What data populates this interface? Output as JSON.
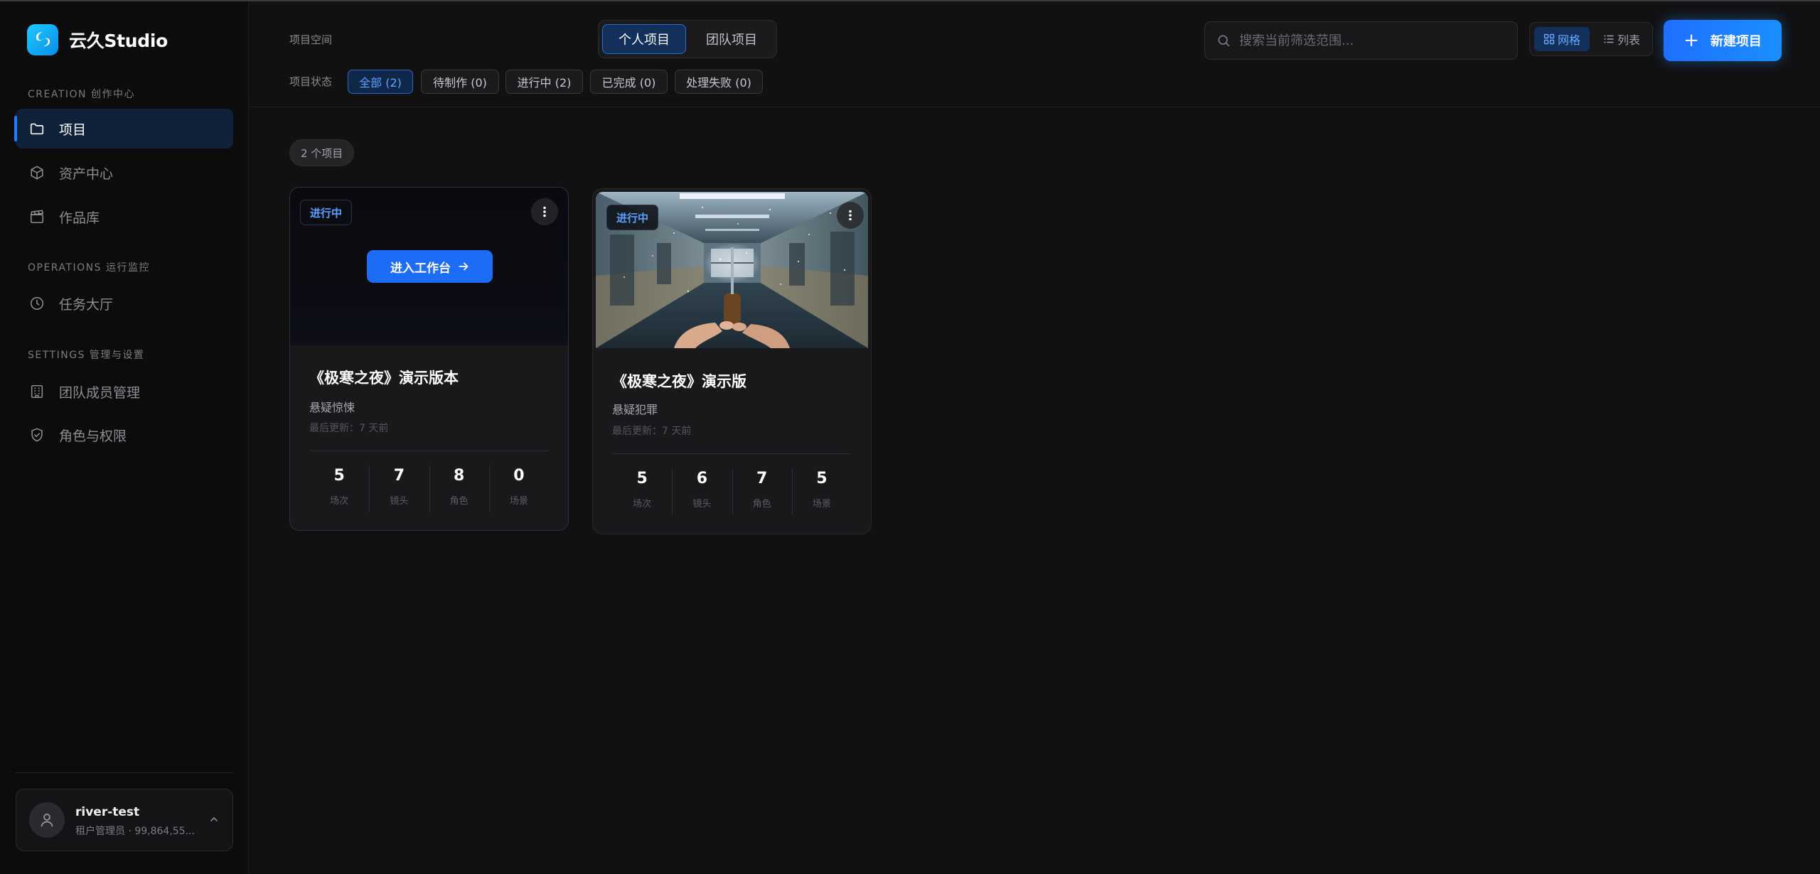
{
  "app": {
    "name": "云久Studio"
  },
  "sidebar": {
    "sections": [
      {
        "label": "CREATION 创作中心"
      },
      {
        "label": "OPERATIONS 运行监控"
      },
      {
        "label": "SETTINGS 管理与设置"
      }
    ],
    "items": [
      {
        "label": "项目",
        "icon": "folder-icon",
        "active": true
      },
      {
        "label": "资产中心",
        "icon": "cube-icon"
      },
      {
        "label": "作品库",
        "icon": "clapperboard-icon"
      },
      {
        "label": "任务大厅",
        "icon": "clock-icon"
      },
      {
        "label": "团队成员管理",
        "icon": "building-icon"
      },
      {
        "label": "角色与权限",
        "icon": "shield-check-icon"
      }
    ]
  },
  "user": {
    "name": "river-test",
    "role": "租户管理员 · 99,864,55..."
  },
  "toolbar": {
    "space_label": "项目空间",
    "space_tabs": [
      {
        "label": "个人项目",
        "active": true
      },
      {
        "label": "团队项目"
      }
    ],
    "status_label": "项目状态",
    "status_chips": [
      {
        "label": "全部 (2)",
        "active": true
      },
      {
        "label": "待制作 (0)"
      },
      {
        "label": "进行中 (2)"
      },
      {
        "label": "已完成 (0)"
      },
      {
        "label": "处理失败 (0)"
      }
    ],
    "search_placeholder": "搜索当前筛选范围...",
    "view_grid": "网格",
    "view_list": "列表",
    "new_project": "新建项目"
  },
  "count_label": "2 个项目",
  "projects": [
    {
      "status": "进行中",
      "enter_label": "进入工作台",
      "title": "《极寒之夜》演示版本",
      "genre": "悬疑惊悚",
      "updated": "最后更新：7 天前",
      "stats": [
        {
          "value": "5",
          "label": "场次"
        },
        {
          "value": "7",
          "label": "镜头"
        },
        {
          "value": "8",
          "label": "角色"
        },
        {
          "value": "0",
          "label": "场景"
        }
      ]
    },
    {
      "status": "进行中",
      "title": "《极寒之夜》演示版",
      "genre": "悬疑犯罪",
      "updated": "最后更新：7 天前",
      "stats": [
        {
          "value": "5",
          "label": "场次"
        },
        {
          "value": "6",
          "label": "镜头"
        },
        {
          "value": "7",
          "label": "角色"
        },
        {
          "value": "5",
          "label": "场景"
        }
      ]
    }
  ],
  "colors": {
    "accent": "#1f7cff",
    "background": "#111112",
    "sidebar": "#0c0c0d",
    "status": "#5aa0ff"
  }
}
